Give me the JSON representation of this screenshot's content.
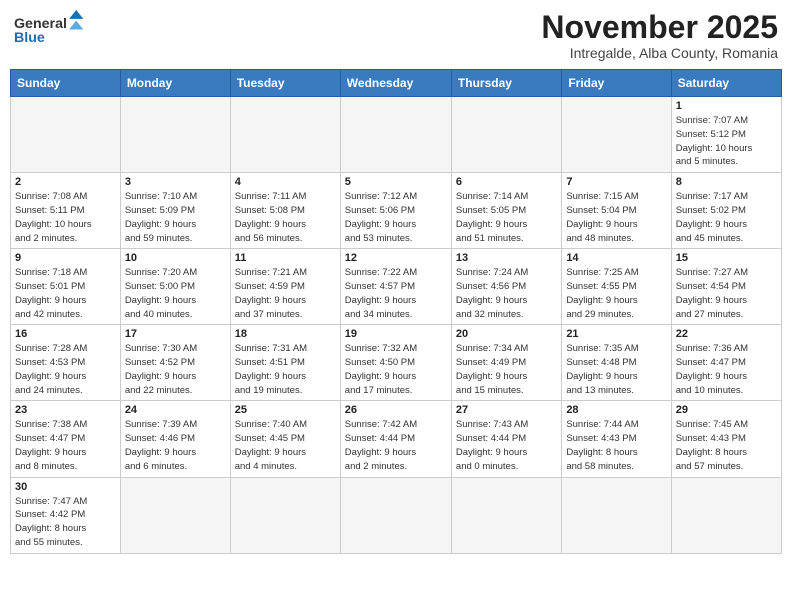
{
  "header": {
    "logo_line1": "General",
    "logo_line2": "Blue",
    "month_title": "November 2025",
    "subtitle": "Intregalde, Alba County, Romania"
  },
  "days_of_week": [
    "Sunday",
    "Monday",
    "Tuesday",
    "Wednesday",
    "Thursday",
    "Friday",
    "Saturday"
  ],
  "weeks": [
    {
      "days": [
        {
          "num": "",
          "info": ""
        },
        {
          "num": "",
          "info": ""
        },
        {
          "num": "",
          "info": ""
        },
        {
          "num": "",
          "info": ""
        },
        {
          "num": "",
          "info": ""
        },
        {
          "num": "",
          "info": ""
        },
        {
          "num": "1",
          "info": "Sunrise: 7:07 AM\nSunset: 5:12 PM\nDaylight: 10 hours\nand 5 minutes."
        }
      ]
    },
    {
      "days": [
        {
          "num": "2",
          "info": "Sunrise: 7:08 AM\nSunset: 5:11 PM\nDaylight: 10 hours\nand 2 minutes."
        },
        {
          "num": "3",
          "info": "Sunrise: 7:10 AM\nSunset: 5:09 PM\nDaylight: 9 hours\nand 59 minutes."
        },
        {
          "num": "4",
          "info": "Sunrise: 7:11 AM\nSunset: 5:08 PM\nDaylight: 9 hours\nand 56 minutes."
        },
        {
          "num": "5",
          "info": "Sunrise: 7:12 AM\nSunset: 5:06 PM\nDaylight: 9 hours\nand 53 minutes."
        },
        {
          "num": "6",
          "info": "Sunrise: 7:14 AM\nSunset: 5:05 PM\nDaylight: 9 hours\nand 51 minutes."
        },
        {
          "num": "7",
          "info": "Sunrise: 7:15 AM\nSunset: 5:04 PM\nDaylight: 9 hours\nand 48 minutes."
        },
        {
          "num": "8",
          "info": "Sunrise: 7:17 AM\nSunset: 5:02 PM\nDaylight: 9 hours\nand 45 minutes."
        }
      ]
    },
    {
      "days": [
        {
          "num": "9",
          "info": "Sunrise: 7:18 AM\nSunset: 5:01 PM\nDaylight: 9 hours\nand 42 minutes."
        },
        {
          "num": "10",
          "info": "Sunrise: 7:20 AM\nSunset: 5:00 PM\nDaylight: 9 hours\nand 40 minutes."
        },
        {
          "num": "11",
          "info": "Sunrise: 7:21 AM\nSunset: 4:59 PM\nDaylight: 9 hours\nand 37 minutes."
        },
        {
          "num": "12",
          "info": "Sunrise: 7:22 AM\nSunset: 4:57 PM\nDaylight: 9 hours\nand 34 minutes."
        },
        {
          "num": "13",
          "info": "Sunrise: 7:24 AM\nSunset: 4:56 PM\nDaylight: 9 hours\nand 32 minutes."
        },
        {
          "num": "14",
          "info": "Sunrise: 7:25 AM\nSunset: 4:55 PM\nDaylight: 9 hours\nand 29 minutes."
        },
        {
          "num": "15",
          "info": "Sunrise: 7:27 AM\nSunset: 4:54 PM\nDaylight: 9 hours\nand 27 minutes."
        }
      ]
    },
    {
      "days": [
        {
          "num": "16",
          "info": "Sunrise: 7:28 AM\nSunset: 4:53 PM\nDaylight: 9 hours\nand 24 minutes."
        },
        {
          "num": "17",
          "info": "Sunrise: 7:30 AM\nSunset: 4:52 PM\nDaylight: 9 hours\nand 22 minutes."
        },
        {
          "num": "18",
          "info": "Sunrise: 7:31 AM\nSunset: 4:51 PM\nDaylight: 9 hours\nand 19 minutes."
        },
        {
          "num": "19",
          "info": "Sunrise: 7:32 AM\nSunset: 4:50 PM\nDaylight: 9 hours\nand 17 minutes."
        },
        {
          "num": "20",
          "info": "Sunrise: 7:34 AM\nSunset: 4:49 PM\nDaylight: 9 hours\nand 15 minutes."
        },
        {
          "num": "21",
          "info": "Sunrise: 7:35 AM\nSunset: 4:48 PM\nDaylight: 9 hours\nand 13 minutes."
        },
        {
          "num": "22",
          "info": "Sunrise: 7:36 AM\nSunset: 4:47 PM\nDaylight: 9 hours\nand 10 minutes."
        }
      ]
    },
    {
      "days": [
        {
          "num": "23",
          "info": "Sunrise: 7:38 AM\nSunset: 4:47 PM\nDaylight: 9 hours\nand 8 minutes."
        },
        {
          "num": "24",
          "info": "Sunrise: 7:39 AM\nSunset: 4:46 PM\nDaylight: 9 hours\nand 6 minutes."
        },
        {
          "num": "25",
          "info": "Sunrise: 7:40 AM\nSunset: 4:45 PM\nDaylight: 9 hours\nand 4 minutes."
        },
        {
          "num": "26",
          "info": "Sunrise: 7:42 AM\nSunset: 4:44 PM\nDaylight: 9 hours\nand 2 minutes."
        },
        {
          "num": "27",
          "info": "Sunrise: 7:43 AM\nSunset: 4:44 PM\nDaylight: 9 hours\nand 0 minutes."
        },
        {
          "num": "28",
          "info": "Sunrise: 7:44 AM\nSunset: 4:43 PM\nDaylight: 8 hours\nand 58 minutes."
        },
        {
          "num": "29",
          "info": "Sunrise: 7:45 AM\nSunset: 4:43 PM\nDaylight: 8 hours\nand 57 minutes."
        }
      ]
    },
    {
      "days": [
        {
          "num": "30",
          "info": "Sunrise: 7:47 AM\nSunset: 4:42 PM\nDaylight: 8 hours\nand 55 minutes."
        },
        {
          "num": "",
          "info": ""
        },
        {
          "num": "",
          "info": ""
        },
        {
          "num": "",
          "info": ""
        },
        {
          "num": "",
          "info": ""
        },
        {
          "num": "",
          "info": ""
        },
        {
          "num": "",
          "info": ""
        }
      ]
    }
  ]
}
